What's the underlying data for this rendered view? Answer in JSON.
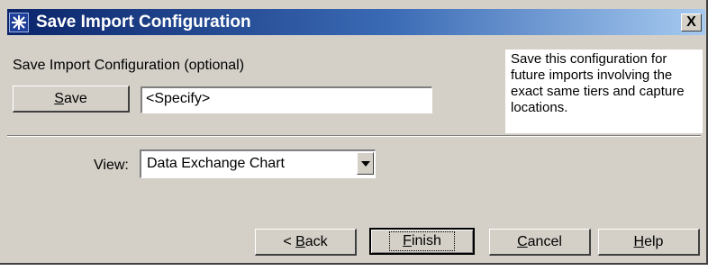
{
  "window": {
    "title": "Save Import Configuration",
    "close_label": "X"
  },
  "section": {
    "heading": "Save Import Configuration (optional)"
  },
  "save": {
    "button_label": "Save",
    "input_value": "<Specify>"
  },
  "help": {
    "text": "Save this configuration for\nfuture imports involving the\nexact same tiers and capture\nlocations."
  },
  "view": {
    "label": "View:",
    "selected": "Data Exchange Chart"
  },
  "footer": {
    "back_label": "< Back",
    "finish_label": "Finish",
    "cancel_label": "Cancel",
    "help_label": "Help"
  },
  "colors": {
    "titlebar_start": "#0a246a",
    "titlebar_end": "#a6caf0",
    "dialog_bg": "#d4d0c8"
  }
}
